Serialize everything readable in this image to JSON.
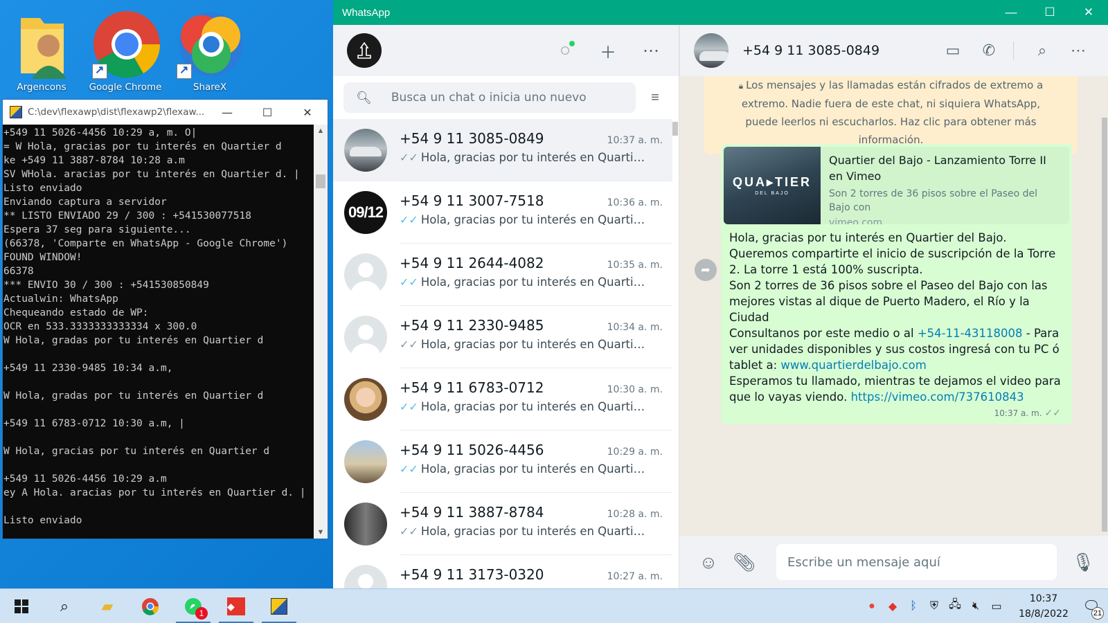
{
  "desktop": {
    "icons": [
      {
        "label": "Argencons"
      },
      {
        "label": "Google Chrome"
      },
      {
        "label": "ShareX"
      }
    ]
  },
  "console": {
    "title": "C:\\dev\\flexawp\\dist\\flexawp2\\flexaw...",
    "lines": "+549 11 5026-4456 10:29 a, m. O|\n= W Hola, gracias por tu interés en Quartier d\nke +549 11 3887-8784 10:28 a.m\nSV WHola. aracias por tu interés en Quartier d. |\nListo enviado\nEnviando captura a servidor\n** LISTO ENVIADO 29 / 300 : +541530077518\nEspera 37 seg para siguiente...\n(66378, 'Comparte en WhatsApp - Google Chrome')\nFOUND WINDOW!\n66378\n*** ENVIO 30 / 300 : +541530850849\nActualwin: WhatsApp\nChequeando estado de WP:\nOCR en 533.3333333333334 x 300.0\nW Hola, gradas por tu interés en Quartier d\n\n+549 11 2330-9485 10:34 a.m,\n\nW Hola, gradas por tu interés en Quartier d\n\n+549 11 6783-0712 10:30 a.m, |\n\nW Hola, gracias por tu interés en Quartier d\n\n+549 11 5026-4456 10:29 a.m\ney A Hola. aracias por tu interés en Quartier d. |\n\nListo enviado"
  },
  "whatsapp": {
    "window_title": "WhatsApp",
    "search": {
      "placeholder": "Busca un chat o inicia uno nuevo"
    },
    "chats": [
      {
        "name": "+54 9 11 3085-0849",
        "time": "10:37 a. m.",
        "preview": "Hola, gracias por tu interés en Quartier d...",
        "tick": "read-grey",
        "avatar": "car"
      },
      {
        "name": "+54 9 11 3007-7518",
        "time": "10:36 a. m.",
        "preview": "Hola, gracias por tu interés en Quartier d...",
        "tick": "read-blue",
        "avatar": "badge",
        "avatar_text": "09/12"
      },
      {
        "name": "+54 9 11 2644-4082",
        "time": "10:35 a. m.",
        "preview": "Hola, gracias por tu interés en Quartier d...",
        "tick": "read-blue",
        "avatar": "default"
      },
      {
        "name": "+54 9 11 2330-9485",
        "time": "10:34 a. m.",
        "preview": "Hola, gracias por tu interés en Quartier d...",
        "tick": "read-grey",
        "avatar": "default"
      },
      {
        "name": "+54 9 11 6783-0712",
        "time": "10:30 a. m.",
        "preview": "Hola, gracias por tu interés en Quartier d...",
        "tick": "read-blue",
        "avatar": "child"
      },
      {
        "name": "+54 9 11 5026-4456",
        "time": "10:29 a. m.",
        "preview": "Hola, gracias por tu interés en Quartier d...",
        "tick": "read-blue",
        "avatar": "city"
      },
      {
        "name": "+54 9 11 3887-8784",
        "time": "10:28 a. m.",
        "preview": "Hola, gracias por tu interés en Quartier d...",
        "tick": "read-grey",
        "avatar": "couple"
      },
      {
        "name": "+54 9 11 3173-0320",
        "time": "10:27 a. m.",
        "preview": "",
        "tick": "",
        "avatar": "default"
      }
    ],
    "conversation": {
      "contact": "+54 9 11 3085-0849",
      "encryption_note": "Los mensajes y las llamadas están cifrados de extremo a extremo. Nadie fuera de este chat, ni siquiera WhatsApp, puede leerlos ni escucharlos. Haz clic para obtener más información.",
      "link_preview": {
        "title": "Quartier del Bajo - Lanzamiento Torre II en Vimeo",
        "description": "Son 2 torres de 36 pisos sobre el Paseo del Bajo con",
        "domain": "vimeo.com",
        "thumb_brand": "QUA▸TIER",
        "thumb_sub": "DEL BAJO"
      },
      "message": {
        "p1": "Hola, gracias por tu interés en Quartier del Bajo. Queremos compartirte el inicio de suscripción de la Torre 2. La torre 1 está 100% suscripta.",
        "p2": "Son 2 torres de 36 pisos sobre el Paseo del Bajo con las mejores vistas al dique de Puerto Madero, el Río y la Ciudad",
        "p3_pre": "Consultanos por este medio o al ",
        "phone": "+54-11-43118008",
        "p3_mid": " - Para ver unidades disponibles y sus costos ingresá con tu PC ó tablet a: ",
        "site": "www.quartierdelbajo.com",
        "p4_pre": "Esperamos tu llamado, mientras te dejamos el video para que lo vayas viendo. ",
        "video_link": "https://vimeo.com/737610843",
        "time": "10:37 a. m."
      },
      "composer_placeholder": "Escribe un mensaje aquí"
    }
  },
  "taskbar": {
    "whatsapp_badge": "1",
    "clock_time": "10:37",
    "clock_date": "18/8/2022",
    "notification_count": "21"
  },
  "colors": {
    "whatsapp_green": "#00a884",
    "outgoing_bubble": "#d9fdd3",
    "link_blue": "#027eb5"
  }
}
